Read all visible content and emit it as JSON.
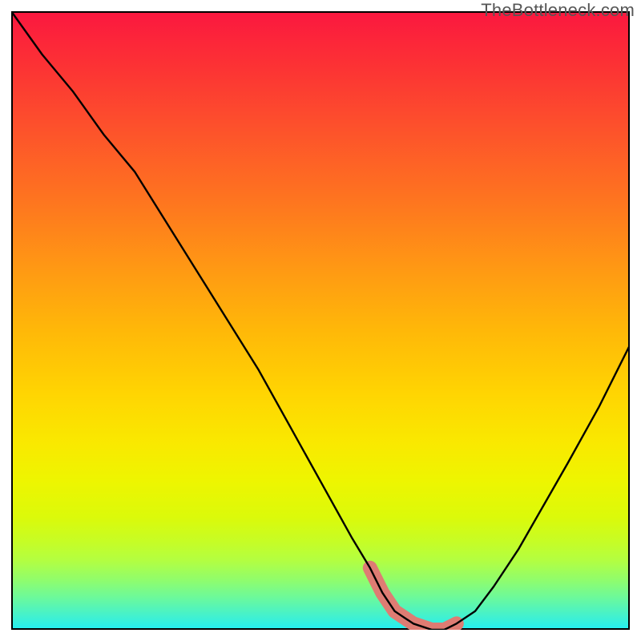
{
  "watermark": "TheBottleneck.com",
  "chart_data": {
    "type": "line",
    "title": "",
    "xlabel": "",
    "ylabel": "",
    "xlim": [
      0,
      100
    ],
    "ylim": [
      0,
      100
    ],
    "grid": false,
    "series": [
      {
        "name": "bottleneck-curve",
        "x": [
          0,
          5,
          10,
          15,
          20,
          25,
          30,
          35,
          40,
          45,
          50,
          55,
          58,
          60,
          62,
          65,
          68,
          70,
          72,
          75,
          78,
          82,
          86,
          90,
          95,
          100
        ],
        "y": [
          100,
          93,
          87,
          80,
          74,
          66,
          58,
          50,
          42,
          33,
          24,
          15,
          10,
          6,
          3,
          1,
          0,
          0,
          1,
          3,
          7,
          13,
          20,
          27,
          36,
          46
        ]
      },
      {
        "name": "highlight-band",
        "x": [
          58,
          60,
          62,
          65,
          68,
          70,
          72
        ],
        "y": [
          10,
          6,
          3,
          1,
          0,
          0,
          1
        ]
      }
    ],
    "colors": {
      "curve": "#000000",
      "highlight": "#de7c73"
    }
  }
}
